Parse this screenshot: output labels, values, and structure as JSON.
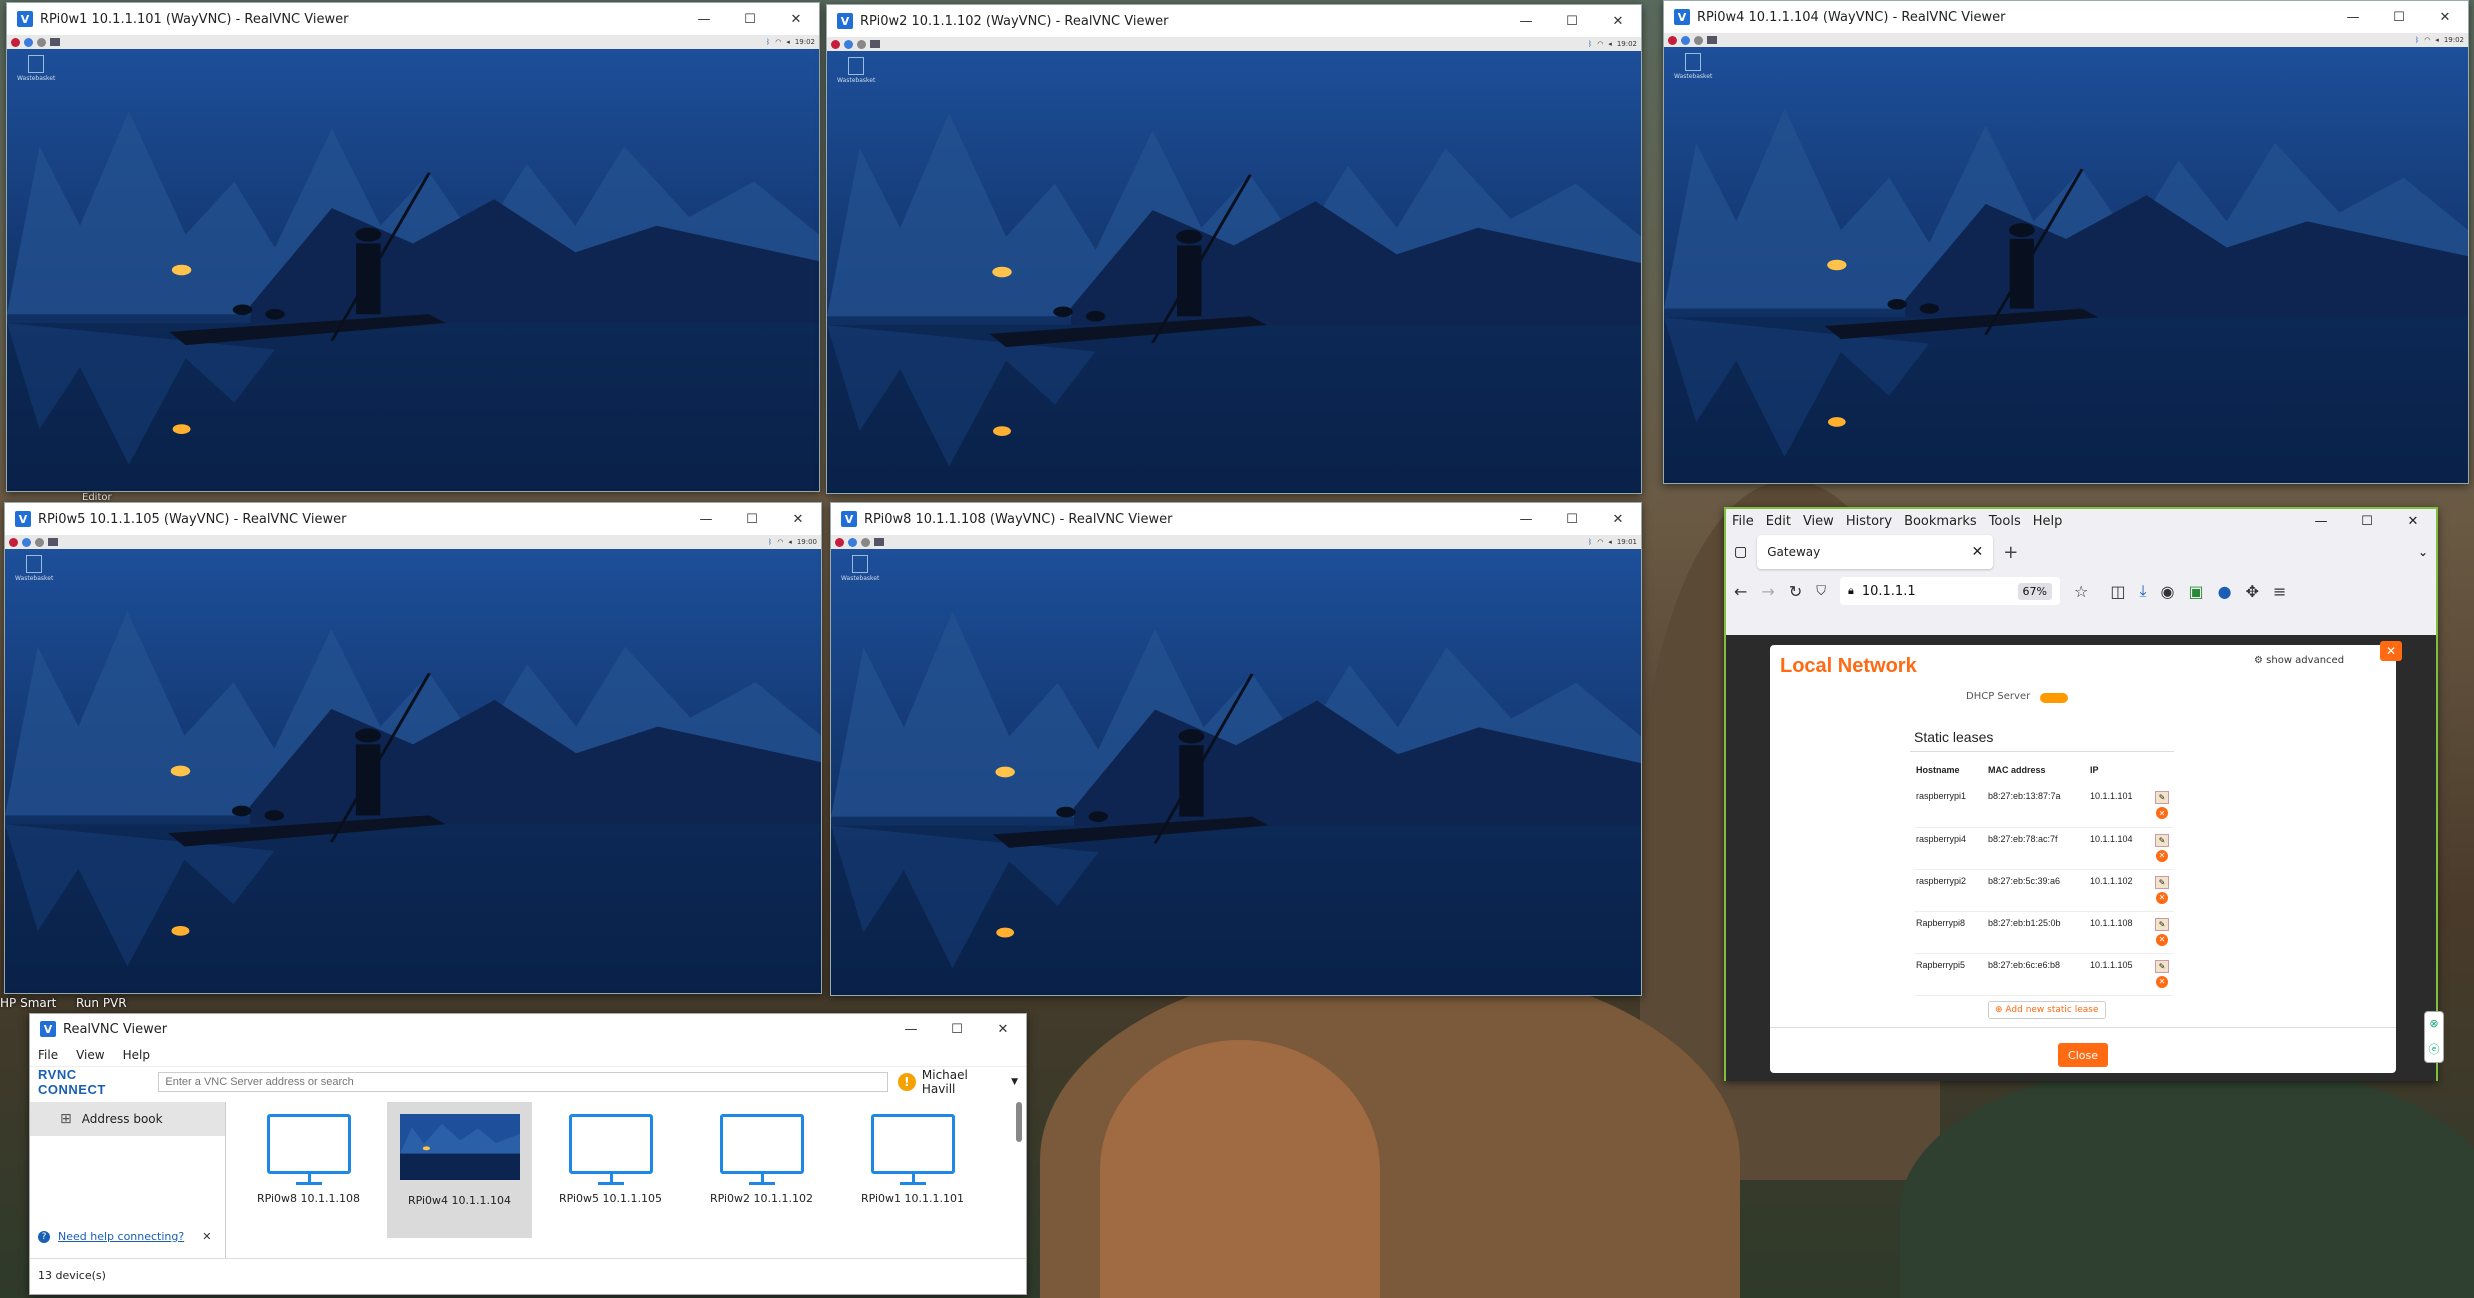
{
  "desktop": {
    "icons": [
      "HP Smart",
      "Run PVR",
      "Editor"
    ]
  },
  "vnc_windows": [
    {
      "id": "w1",
      "title": "RPi0w1 10.1.1.101 (WayVNC) - RealVNC Viewer",
      "clock": "19:02",
      "trash": "Wastebasket"
    },
    {
      "id": "w2",
      "title": "RPi0w2 10.1.1.102 (WayVNC) - RealVNC Viewer",
      "clock": "19:02",
      "trash": "Wastebasket"
    },
    {
      "id": "w4",
      "title": "RPi0w4 10.1.1.104 (WayVNC) - RealVNC Viewer",
      "clock": "19:02",
      "trash": "Wastebasket"
    },
    {
      "id": "w5",
      "title": "RPi0w5 10.1.1.105 (WayVNC) - RealVNC Viewer",
      "clock": "19:00",
      "trash": "Wastebasket"
    },
    {
      "id": "w8",
      "title": "RPi0w8 10.1.1.108 (WayVNC) - RealVNC Viewer",
      "clock": "19:01",
      "trash": "Wastebasket"
    }
  ],
  "window_controls": {
    "minimize": "—",
    "maximize": "☐",
    "close": "✕"
  },
  "firefox": {
    "menu": [
      "File",
      "Edit",
      "View",
      "History",
      "Bookmarks",
      "Tools",
      "Help"
    ],
    "tab_title": "Gateway",
    "url": "10.1.1.1",
    "zoom": "67%",
    "page": {
      "title": "Local Network",
      "show_advanced": "show advanced",
      "dhcp_label": "DHCP Server",
      "section": "Static leases",
      "columns": [
        "Hostname",
        "MAC address",
        "IP"
      ],
      "rows": [
        {
          "host": "raspberrypi1",
          "mac": "b8:27:eb:13:87:7a",
          "ip": "10.1.1.101"
        },
        {
          "host": "raspberrypi4",
          "mac": "b8:27:eb:78:ac:7f",
          "ip": "10.1.1.104"
        },
        {
          "host": "raspberrypi2",
          "mac": "b8:27:eb:5c:39:a6",
          "ip": "10.1.1.102"
        },
        {
          "host": "Rapberrypi8",
          "mac": "b8:27:eb:b1:25:0b",
          "ip": "10.1.1.108"
        },
        {
          "host": "Rapberrypi5",
          "mac": "b8:27:eb:6c:e6:b8",
          "ip": "10.1.1.105"
        }
      ],
      "add_button": "Add new static lease",
      "close_button": "Close"
    }
  },
  "realvnc": {
    "title": "RealVNC Viewer",
    "menu": [
      "File",
      "View",
      "Help"
    ],
    "brand": "RVNC CONNECT",
    "search_placeholder": "Enter a VNC Server address or search",
    "user": "Michael Havill",
    "address_book": "Address book",
    "help_link": "Need help connecting?",
    "devices": [
      {
        "label": "RPi0w8 10.1.1.108",
        "thumb": false,
        "selected": false
      },
      {
        "label": "RPi0w4 10.1.1.104",
        "thumb": true,
        "selected": true
      },
      {
        "label": "RPi0w5 10.1.1.105",
        "thumb": false,
        "selected": false
      },
      {
        "label": "RPi0w2 10.1.1.102",
        "thumb": false,
        "selected": false
      },
      {
        "label": "RPi0w1 10.1.1.101",
        "thumb": false,
        "selected": false
      }
    ],
    "status": "13 device(s)"
  }
}
